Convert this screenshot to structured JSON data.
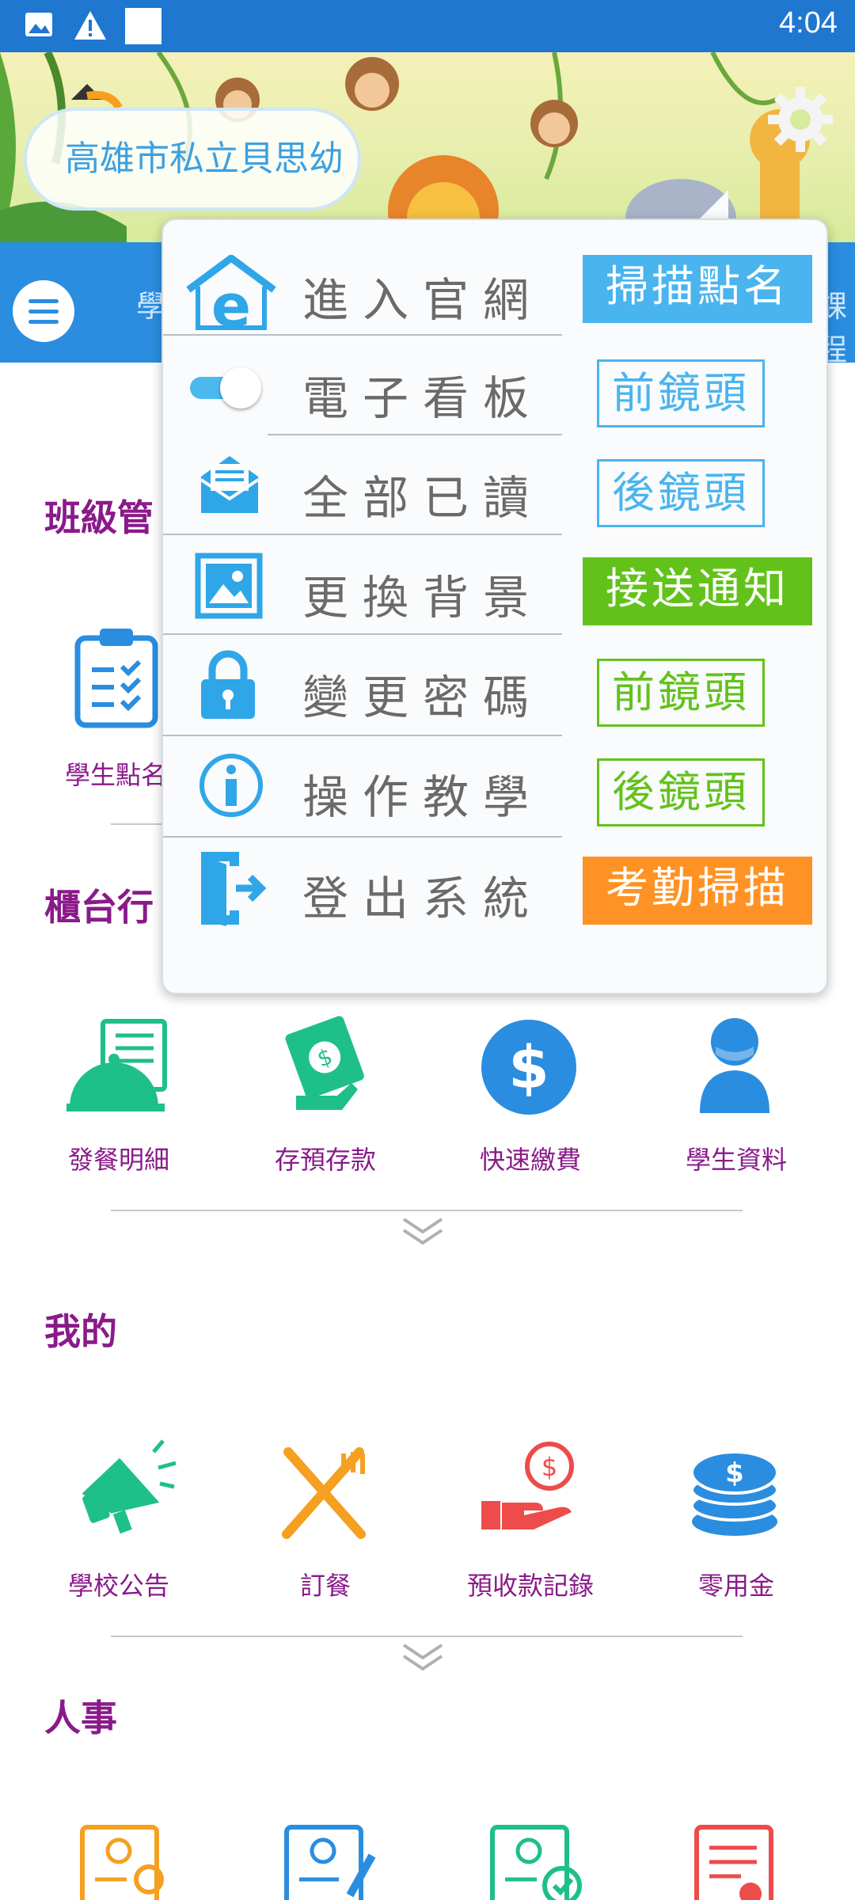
{
  "status_bar": {
    "time": "4:04",
    "icons": [
      "image-icon",
      "warning-icon",
      "square-icon"
    ]
  },
  "banner": {
    "school_name": "高雄市私立貝思幼",
    "settings_icon": "gear-icon"
  },
  "navbar": {
    "left_text": "學",
    "right_text": "課程"
  },
  "sections": {
    "class": {
      "title": "班級管",
      "tiles": [
        {
          "label": "學生點名",
          "icon": "clipboard-check-icon"
        }
      ]
    },
    "counter": {
      "title": "櫃台行",
      "tiles": [
        {
          "label": "發餐明細",
          "icon": "meal-cloche-icon"
        },
        {
          "label": "存預存款",
          "icon": "money-hand-icon"
        },
        {
          "label": "快速繳費",
          "icon": "dollar-circle-icon"
        },
        {
          "label": "學生資料",
          "icon": "person-icon"
        }
      ]
    },
    "mine": {
      "title": "我的",
      "tiles": [
        {
          "label": "學校公告",
          "icon": "megaphone-icon"
        },
        {
          "label": "訂餐",
          "icon": "fork-knife-icon"
        },
        {
          "label": "預收款記錄",
          "icon": "coin-hand-icon"
        },
        {
          "label": "零用金",
          "icon": "coin-stack-icon"
        }
      ]
    },
    "hr": {
      "title": "人事",
      "tiles": [
        {
          "icon": "profile-search-icon"
        },
        {
          "icon": "profile-edit-icon"
        },
        {
          "icon": "profile-check-icon"
        },
        {
          "icon": "document-clock-icon"
        }
      ]
    }
  },
  "popup": {
    "menu": [
      {
        "label": "進入官網",
        "icon": "home-web-icon"
      },
      {
        "label": "電子看板",
        "icon": "toggle-switch",
        "toggle_on": true
      },
      {
        "label": "全部已讀",
        "icon": "envelope-open-icon"
      },
      {
        "label": "更換背景",
        "icon": "picture-icon"
      },
      {
        "label": "變更密碼",
        "icon": "lock-icon"
      },
      {
        "label": "操作教學",
        "icon": "info-icon"
      },
      {
        "label": "登出系統",
        "icon": "logout-door-icon"
      }
    ],
    "buttons": [
      {
        "label": "掃描點名",
        "style": "filled",
        "color": "#4ab4ee"
      },
      {
        "label": "前鏡頭",
        "style": "outline",
        "color": "#4ab4ee"
      },
      {
        "label": "後鏡頭",
        "style": "outline",
        "color": "#4ab4ee"
      },
      {
        "label": "接送通知",
        "style": "filled",
        "color": "#62c21a"
      },
      {
        "label": "前鏡頭",
        "style": "outline",
        "color": "#62c21a"
      },
      {
        "label": "後鏡頭",
        "style": "outline",
        "color": "#62c21a"
      },
      {
        "label": "考勤掃描",
        "style": "filled",
        "color": "#ff9224"
      }
    ]
  },
  "colors": {
    "primary": "#2a8de0",
    "section_title": "#8a1a8a",
    "icon_green": "#1fbf8a",
    "icon_blue": "#2a8de0",
    "icon_orange": "#f5a020",
    "icon_red": "#ee4b4b"
  }
}
